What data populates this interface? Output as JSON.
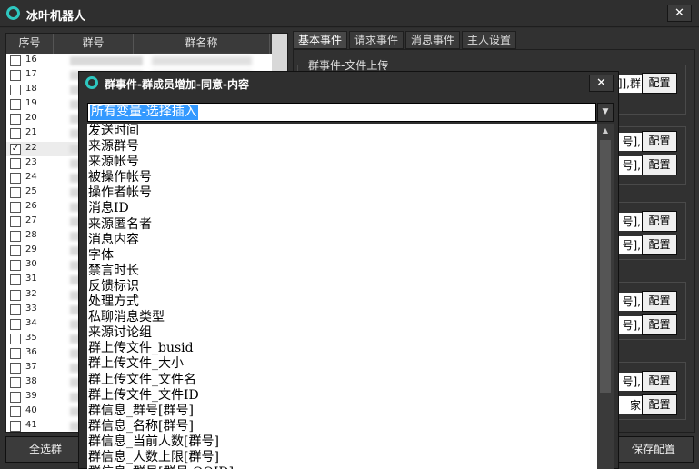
{
  "window": {
    "title": "冰叶机器人",
    "close_glyph": "✕",
    "logo_color": "#2ec7c0"
  },
  "group_list": {
    "headers": [
      "序号",
      "群号",
      "群名称"
    ],
    "rows": [
      {
        "no": "16",
        "checked": false
      },
      {
        "no": "17",
        "checked": false
      },
      {
        "no": "18",
        "checked": false
      },
      {
        "no": "19",
        "checked": false
      },
      {
        "no": "20",
        "checked": false
      },
      {
        "no": "21",
        "checked": false
      },
      {
        "no": "22",
        "checked": true
      },
      {
        "no": "23",
        "checked": false
      },
      {
        "no": "24",
        "checked": false
      },
      {
        "no": "25",
        "checked": false
      },
      {
        "no": "26",
        "checked": false
      },
      {
        "no": "27",
        "checked": false
      },
      {
        "no": "28",
        "checked": false
      },
      {
        "no": "29",
        "checked": false
      },
      {
        "no": "30",
        "checked": false
      },
      {
        "no": "31",
        "checked": false
      },
      {
        "no": "32",
        "checked": false
      },
      {
        "no": "33",
        "checked": false
      },
      {
        "no": "34",
        "checked": false
      },
      {
        "no": "35",
        "checked": false
      },
      {
        "no": "36",
        "checked": false
      },
      {
        "no": "37",
        "checked": false
      },
      {
        "no": "38",
        "checked": false
      },
      {
        "no": "39",
        "checked": false
      },
      {
        "no": "40",
        "checked": false
      },
      {
        "no": "41",
        "checked": false
      }
    ]
  },
  "tabs": [
    "基本事件",
    "请求事件",
    "消息事件",
    "主人设置"
  ],
  "active_tab": 0,
  "event_panel": {
    "first_box_title": "群事件-文件上传",
    "field_values": [
      "]],群",
      "号],",
      "号],",
      "号],",
      "号],",
      "号],",
      "号],",
      "号],",
      "号],",
      "家号],"
    ],
    "config_label": "配置"
  },
  "buttons": {
    "select_all": "全选群",
    "save_config": "保存配置"
  },
  "dialog": {
    "title": "群事件-群成员增加-同意-内容",
    "close_glyph": "✕",
    "combo_value": "所有变量-选择插入",
    "combo_arrow_glyph": "▼",
    "scroll_up_glyph": "▲",
    "variables": [
      "发送时间",
      "来源群号",
      "来源帐号",
      "被操作帐号",
      "操作者帐号",
      "消息ID",
      "来源匿名者",
      "消息内容",
      "字体",
      "禁言时长",
      "反馈标识",
      "处理方式",
      "私聊消息类型",
      "来源讨论组",
      "群上传文件_busid",
      "群上传文件_大小",
      "群上传文件_文件名",
      "群上传文件_文件ID",
      "群信息_群号[群号]",
      "群信息_名称[群号]",
      "群信息_当前人数[群号]",
      "群信息_人数上限[群号]",
      "群信息_群员[群号,QQID]"
    ]
  }
}
